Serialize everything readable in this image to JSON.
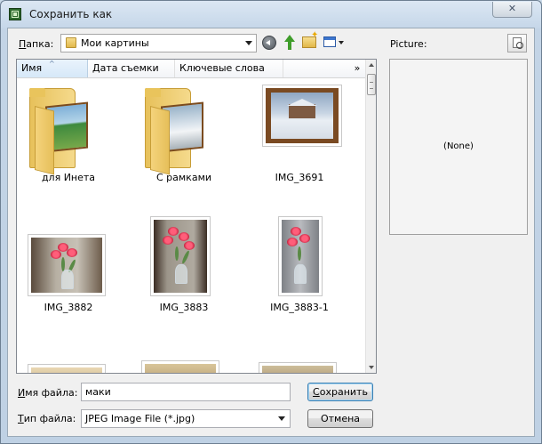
{
  "window": {
    "title": "Сохранить как",
    "close_label": "✕"
  },
  "toolbar": {
    "folder_label_accel": "П",
    "folder_label_rest": "апка:",
    "folder_value": "Мои картины"
  },
  "columns": [
    {
      "label": "Имя",
      "sorted": true
    },
    {
      "label": "Дата съемки",
      "sorted": false
    },
    {
      "label": "Ключевые слова",
      "sorted": false
    }
  ],
  "columns_more": "»",
  "items": [
    {
      "label": "для Инета",
      "kind": "folder"
    },
    {
      "label": "С рамками",
      "kind": "folder"
    },
    {
      "label": "IMG_3691",
      "kind": "photo-landscape"
    },
    {
      "label": "IMG_3882",
      "kind": "photo-landscape"
    },
    {
      "label": "IMG_3883",
      "kind": "photo-portrait"
    },
    {
      "label": "IMG_3883-1",
      "kind": "photo-portrait"
    }
  ],
  "preview": {
    "label": "Picture:",
    "empty_text": "(None)"
  },
  "filename": {
    "label_accel": "И",
    "label_rest": "мя файла:",
    "value": "маки"
  },
  "filetype": {
    "label_accel": "Т",
    "label_rest": "ип файла:",
    "value": "JPEG Image File (*.jpg)"
  },
  "buttons": {
    "save_accel": "С",
    "save_rest": "охранить",
    "cancel": "Отмена"
  }
}
